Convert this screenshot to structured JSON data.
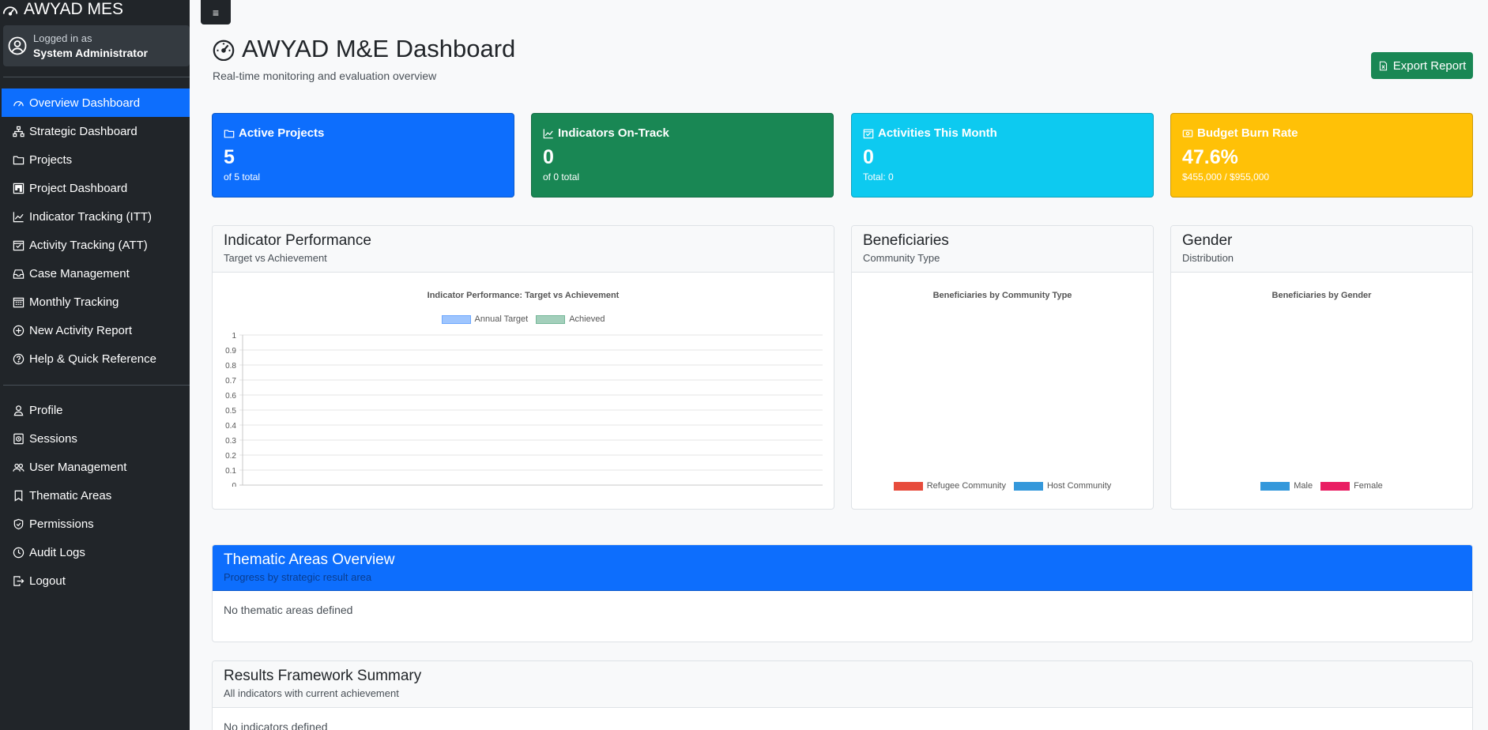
{
  "sidebar": {
    "brand": "AWYAD MES",
    "user": {
      "label": "Logged in as",
      "name": "System Administrator"
    },
    "main_items": [
      {
        "label": "Overview Dashboard",
        "icon": "speedometer-icon",
        "active": true
      },
      {
        "label": "Strategic Dashboard",
        "icon": "diagram-icon"
      },
      {
        "label": "Projects",
        "icon": "folder-icon"
      },
      {
        "label": "Project Dashboard",
        "icon": "kanban-icon"
      },
      {
        "label": "Indicator Tracking (ITT)",
        "icon": "graph-up-icon"
      },
      {
        "label": "Activity Tracking (ATT)",
        "icon": "calendar-check-icon"
      },
      {
        "label": "Case Management",
        "icon": "inbox-icon"
      },
      {
        "label": "Monthly Tracking",
        "icon": "calendar-grid-icon"
      },
      {
        "label": "New Activity Report",
        "icon": "plus-circle-icon"
      },
      {
        "label": "Help & Quick Reference",
        "icon": "question-circle-icon"
      }
    ],
    "admin_items": [
      {
        "label": "Profile",
        "icon": "person-icon"
      },
      {
        "label": "Sessions",
        "icon": "clock-history-icon"
      },
      {
        "label": "User Management",
        "icon": "people-icon"
      },
      {
        "label": "Thematic Areas",
        "icon": "bookmark-icon"
      },
      {
        "label": "Permissions",
        "icon": "shield-icon"
      },
      {
        "label": "Audit Logs",
        "icon": "clock-icon"
      },
      {
        "label": "Logout",
        "icon": "logout-icon"
      }
    ]
  },
  "toggle": {
    "label": "≡"
  },
  "header": {
    "title": "AWYAD M&E Dashboard",
    "subtitle": "Real-time monitoring and evaluation overview",
    "export_label": "Export Report"
  },
  "kpis": {
    "active_projects": {
      "title": "Active Projects",
      "value": "5",
      "sub": "of 5 total"
    },
    "indicators": {
      "title": "Indicators On-Track",
      "value": "0",
      "sub": "of 0 total"
    },
    "activities": {
      "title": "Activities This Month",
      "value": "0",
      "sub": "Total: 0"
    },
    "budget": {
      "title": "Budget Burn Rate",
      "value": "47.6%",
      "sub": "$455,000 / $955,000"
    }
  },
  "cards": {
    "indicator": {
      "title": "Indicator Performance",
      "subtitle": "Target vs Achievement"
    },
    "beneficiaries": {
      "title": "Beneficiaries",
      "subtitle": "Community Type"
    },
    "gender": {
      "title": "Gender",
      "subtitle": "Distribution"
    },
    "thematic": {
      "title": "Thematic Areas Overview",
      "subtitle": "Progress by strategic result area",
      "empty": "No thematic areas defined"
    },
    "results": {
      "title": "Results Framework Summary",
      "subtitle": "All indicators with current achievement",
      "empty": "No indicators defined"
    }
  },
  "chart_data": [
    {
      "type": "bar",
      "title": "Indicator Performance: Target vs Achievement",
      "categories": [],
      "series": [
        {
          "name": "Annual Target",
          "values": [],
          "color": "#9ec5fe"
        },
        {
          "name": "Achieved",
          "values": [],
          "color": "#a3cfbb"
        }
      ],
      "ylim": [
        0,
        1
      ],
      "yticks": [
        "1",
        "0.9",
        "0.8",
        "0.7",
        "0.6",
        "0.5",
        "0.4",
        "0.3",
        "0.2",
        "0.1",
        "0"
      ],
      "grid": true,
      "legend": "top"
    },
    {
      "type": "pie",
      "title": "Beneficiaries by Community Type",
      "categories": [
        "Refugee Community",
        "Host Community"
      ],
      "values": [],
      "colors": [
        "#e74c3c",
        "#3498db"
      ],
      "legend": "bottom"
    },
    {
      "type": "pie",
      "title": "Beneficiaries by Gender",
      "categories": [
        "Male",
        "Female"
      ],
      "values": [],
      "colors": [
        "#3498db",
        "#e91e63"
      ],
      "legend": "bottom"
    }
  ]
}
